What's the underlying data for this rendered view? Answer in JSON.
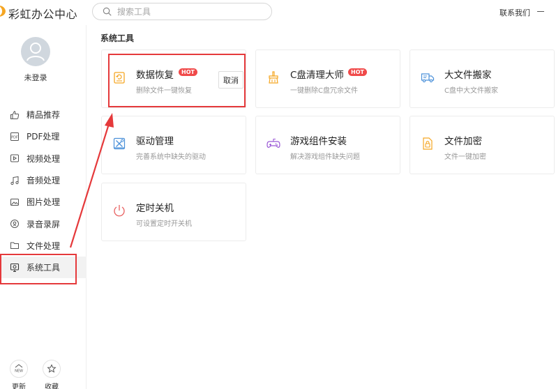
{
  "app": {
    "title": "彩虹办公中心"
  },
  "header": {
    "search_placeholder": "搜索工具",
    "contact_label": "联系我们"
  },
  "user": {
    "login_status": "未登录"
  },
  "sidebar": {
    "items": [
      {
        "label": "精品推荐",
        "icon": "thumbs-up-icon"
      },
      {
        "label": "PDF处理",
        "icon": "pdf-icon"
      },
      {
        "label": "视频处理",
        "icon": "video-icon"
      },
      {
        "label": "音频处理",
        "icon": "music-note-icon"
      },
      {
        "label": "图片处理",
        "icon": "image-icon"
      },
      {
        "label": "录音录屏",
        "icon": "record-icon"
      },
      {
        "label": "文件处理",
        "icon": "folder-icon"
      },
      {
        "label": "系统工具",
        "icon": "monitor-icon",
        "active": true
      }
    ],
    "bottom": [
      {
        "label": "更新",
        "icon": "new-badge-icon"
      },
      {
        "label": "收藏",
        "icon": "star-icon"
      }
    ]
  },
  "main": {
    "section_title": "系统工具",
    "cards": [
      {
        "title": "数据恢复",
        "desc": "删除文件一键恢复",
        "hot": "HOT",
        "icon": "data-recovery-icon",
        "action": "取消"
      },
      {
        "title": "C盘清理大师",
        "desc": "一键删除C盘冗余文件",
        "hot": "HOT",
        "icon": "broom-icon"
      },
      {
        "title": "大文件搬家",
        "desc": "C盘中大文件搬家",
        "icon": "moving-truck-icon"
      },
      {
        "title": "驱动管理",
        "desc": "完善系统中缺失的驱动",
        "icon": "driver-tools-icon"
      },
      {
        "title": "游戏组件安装",
        "desc": "解决游戏组件缺失问题",
        "icon": "gamepad-icon"
      },
      {
        "title": "文件加密",
        "desc": "文件一键加密",
        "icon": "file-lock-icon"
      },
      {
        "title": "定时关机",
        "desc": "可设置定时开关机",
        "icon": "power-icon"
      }
    ]
  },
  "colors": {
    "accent": "#f5a623",
    "hot": "#f04a4a",
    "annotation": "#e5393b"
  }
}
